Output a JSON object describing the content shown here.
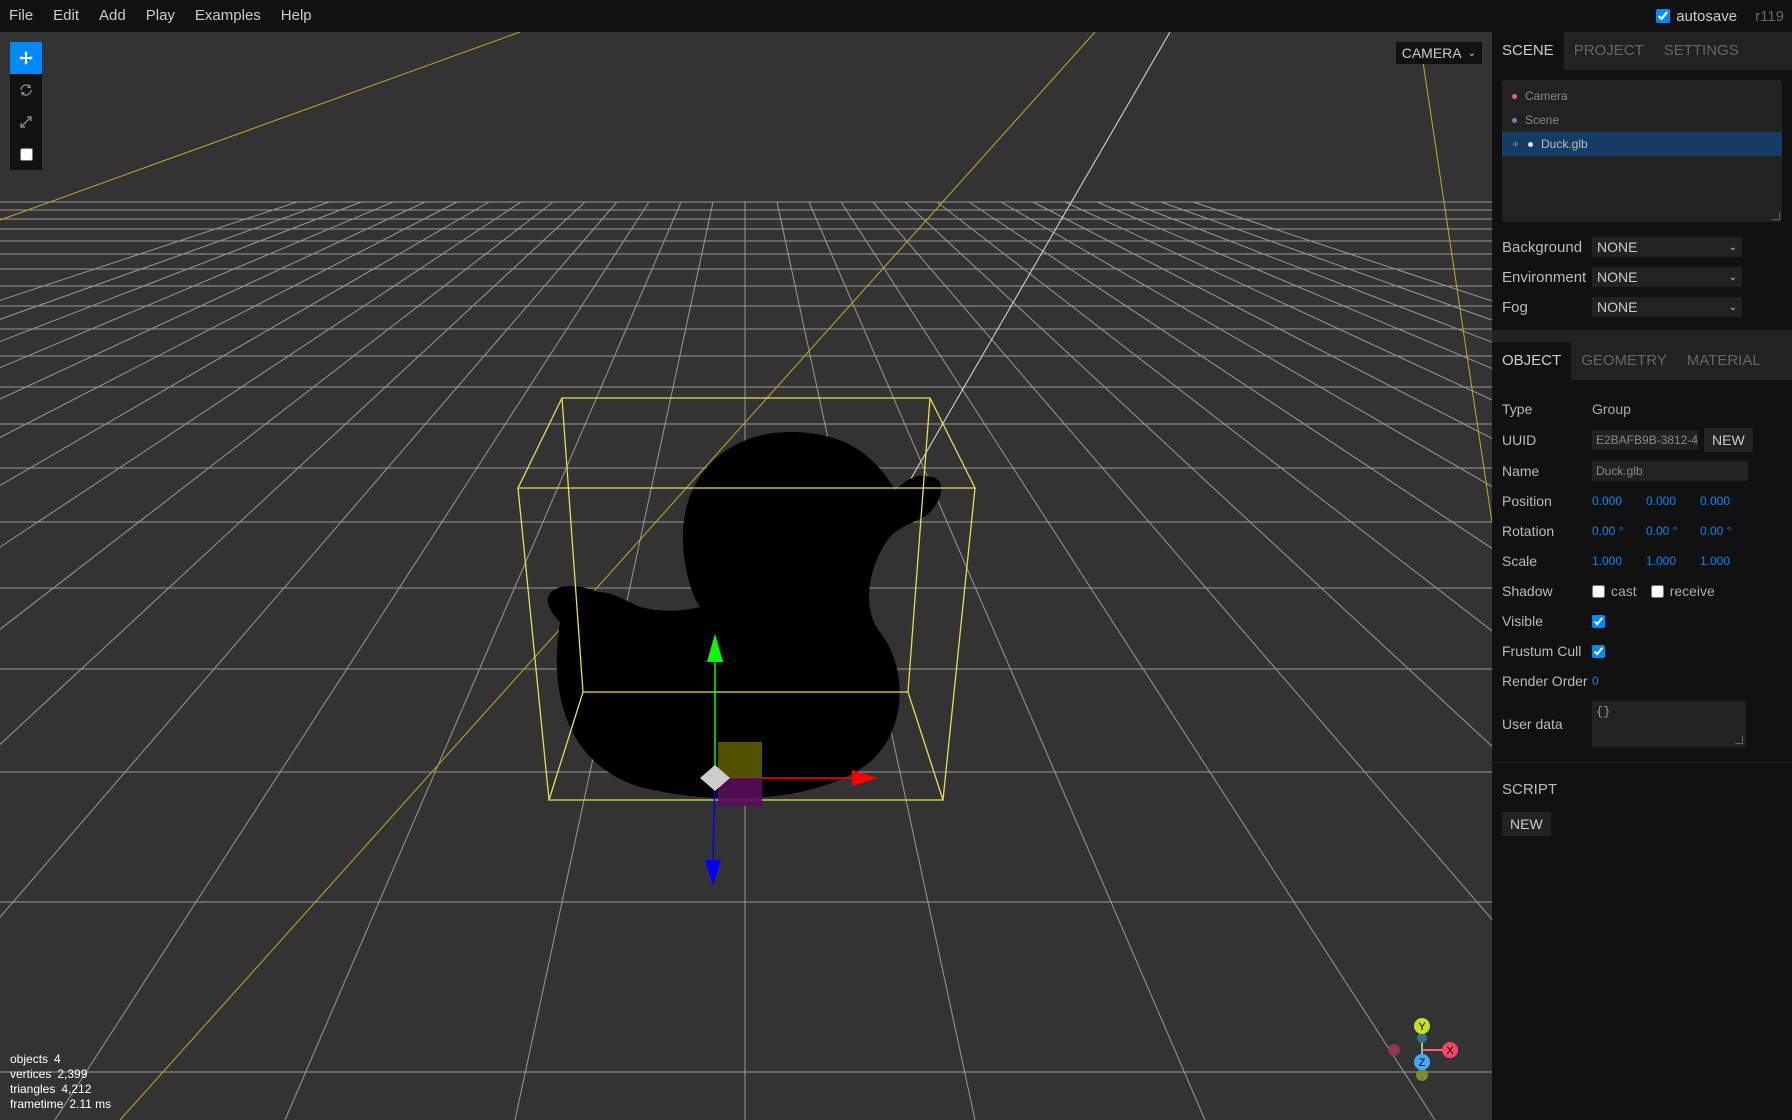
{
  "menubar": {
    "items": [
      "File",
      "Edit",
      "Add",
      "Play",
      "Examples",
      "Help"
    ],
    "autosave_label": "autosave",
    "version": "r119"
  },
  "viewport": {
    "camera_select": "CAMERA",
    "info": {
      "objects_label": "objects",
      "objects": "4",
      "vertices_label": "vertices",
      "vertices": "2,399",
      "triangles_label": "triangles",
      "triangles": "4,212",
      "frametime_label": "frametime",
      "frametime": "2.11 ms"
    },
    "helper_axes": {
      "y": "Y",
      "z": "Z",
      "x": "X"
    }
  },
  "sidebar": {
    "tabs": [
      "SCENE",
      "PROJECT",
      "SETTINGS"
    ],
    "outliner": [
      {
        "label": "Camera",
        "color": "#e2697b"
      },
      {
        "label": "Scene",
        "color": "#8773ba"
      },
      {
        "label": "Duck.glb",
        "color": "#f0f0f0",
        "opener": "+"
      }
    ],
    "background": {
      "label": "Background",
      "value": "NONE"
    },
    "environment": {
      "label": "Environment",
      "value": "NONE"
    },
    "fog": {
      "label": "Fog",
      "value": "NONE"
    },
    "object_tabs": [
      "OBJECT",
      "GEOMETRY",
      "MATERIAL"
    ],
    "object": {
      "type_label": "Type",
      "type": "Group",
      "uuid_label": "UUID",
      "uuid": "E2BAFB9B-3812-4",
      "uuid_button": "NEW",
      "name_label": "Name",
      "name": "Duck.glb",
      "position_label": "Position",
      "position": [
        "0.000",
        "0.000",
        "0.000"
      ],
      "rotation_label": "Rotation",
      "rotation": [
        "0.00 °",
        "0.00 °",
        "0.00 °"
      ],
      "scale_label": "Scale",
      "scale": [
        "1.000",
        "1.000",
        "1.000"
      ],
      "shadow_label": "Shadow",
      "cast_label": "cast",
      "receive_label": "receive",
      "visible_label": "Visible",
      "frustum_label": "Frustum Cull",
      "render_order_label": "Render Order",
      "render_order": "0",
      "user_data_label": "User data",
      "user_data": "{}"
    },
    "script": {
      "title": "SCRIPT",
      "new_button": "NEW"
    }
  }
}
